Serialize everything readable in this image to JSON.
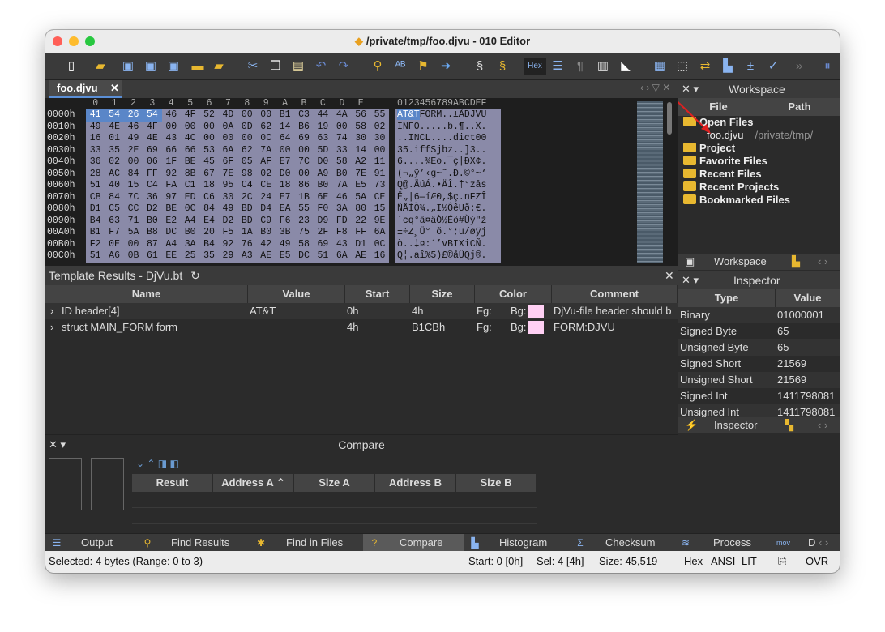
{
  "window": {
    "title": "/private/tmp/foo.djvu - 010 Editor"
  },
  "toolbar": {
    "hex_label": "Hex"
  },
  "doc_tab": {
    "label": "foo.djvu"
  },
  "hex": {
    "col_header": [
      "0",
      "1",
      "2",
      "3",
      "4",
      "5",
      "6",
      "7",
      "8",
      "9",
      "A",
      "B",
      "C",
      "D",
      "E",
      "F"
    ],
    "ascii_header": "0123456789ABCDEF",
    "rows": [
      {
        "addr": "0000h",
        "bytes": "41 54 26 54 46 4F 52 4D 00 00 B1 C3 44 4A 56 55",
        "ascii": "AT&TFORM..±ÃDJVU"
      },
      {
        "addr": "0010h",
        "bytes": "49 4E 46 4F 00 00 00 0A 0D 62 14 B6 19 00 58 02",
        "ascii": "INFO.....b.¶..X."
      },
      {
        "addr": "0020h",
        "bytes": "16 01 49 4E 43 4C 00 00 00 0C 64 69 63 74 30 30",
        "ascii": "..INCL....dict00"
      },
      {
        "addr": "0030h",
        "bytes": "33 35 2E 69 66 66 53 6A 62 7A 00 00 5D 33 14 00",
        "ascii": "35.iffSjbz..]3.."
      },
      {
        "addr": "0040h",
        "bytes": "36 02 00 06 1F BE 45 6F 05 AF E7 7C D0 58 A2 11",
        "ascii": "6....¾Eo.¯ç|ÐX¢."
      },
      {
        "addr": "0050h",
        "bytes": "28 AC 84 FF 92 8B 67 7E 98 02 D0 00 A9 B0 7E 91",
        "ascii": "(¬„ÿ’‹g~˜.Ð.©°~‘"
      },
      {
        "addr": "0060h",
        "bytes": "51 40 15 C4 FA C1 18 95 C4 CE 18 86 B0 7A E5 73",
        "ascii": "Q@.ÄúÁ.•ÄÎ.†°zås"
      },
      {
        "addr": "0070h",
        "bytes": "CB 84 7C 36 97 ED C6 30 2C 24 E7 1B 6E 46 5A CE",
        "ascii": "Ë„|6—íÆ0,$ç.nFZÎ"
      },
      {
        "addr": "0080h",
        "bytes": "D1 C5 CC D2 BE 0C 84 49 BD D4 EA 55 F0 3A 80 15",
        "ascii": "ÑÅÌÒ¾.„I½ÔêUð:€."
      },
      {
        "addr": "0090h",
        "bytes": "B4 63 71 B0 E2 A4 E4 D2 BD C9 F6 23 D9 FD 22 9E",
        "ascii": "´cq°â¤äÒ½Éö#Ùý\"ž"
      },
      {
        "addr": "00A0h",
        "bytes": "B1 F7 5A B8 DC B0 20 F5 1A B0 3B 75 2F F8 FF 6A",
        "ascii": "±÷Z¸Ü° õ.°;u/øÿj"
      },
      {
        "addr": "00B0h",
        "bytes": "F2 0E 00 87 A4 3A B4 92 76 42 49 58 69 43 D1 0C",
        "ascii": "ò..‡¤:´’vBIXiCÑ."
      },
      {
        "addr": "00C0h",
        "bytes": "51 A6 0B 61 EE 25 35 29 A3 AE E5 DC 51 6A AE 16",
        "ascii": "Q¦.aî%5)£®åÜQj®."
      }
    ]
  },
  "template": {
    "title": "Template Results - DjVu.bt",
    "columns": [
      "Name",
      "Value",
      "Start",
      "Size",
      "Color",
      "Comment"
    ],
    "rows": [
      {
        "name": "ID header[4]",
        "value": "AT&T",
        "start": "0h",
        "size": "4h",
        "fg": "Fg:",
        "bg": "Bg:",
        "comment": "DjVu-file header should b"
      },
      {
        "name": "struct MAIN_FORM form",
        "value": "",
        "start": "4h",
        "size": "B1CBh",
        "fg": "Fg:",
        "bg": "Bg:",
        "comment": "FORM:DJVU"
      }
    ]
  },
  "compare": {
    "title": "Compare",
    "columns": [
      "Result",
      "Address A",
      "Size A",
      "Address B",
      "Size B"
    ]
  },
  "workspace": {
    "title": "Workspace",
    "col_file": "File",
    "col_path": "Path",
    "open_files": "Open Files",
    "file_name": "foo.djvu",
    "file_path": "/private/tmp/",
    "items": [
      "Project",
      "Favorite Files",
      "Recent Files",
      "Recent Projects",
      "Bookmarked Files"
    ],
    "tab_label": "Workspace"
  },
  "inspector": {
    "title": "Inspector",
    "col_type": "Type",
    "col_value": "Value",
    "rows": [
      {
        "type": "Binary",
        "value": "01000001"
      },
      {
        "type": "Signed Byte",
        "value": "65"
      },
      {
        "type": "Unsigned Byte",
        "value": "65"
      },
      {
        "type": "Signed Short",
        "value": "21569"
      },
      {
        "type": "Unsigned Short",
        "value": "21569"
      },
      {
        "type": "Signed Int",
        "value": "1411798081"
      },
      {
        "type": "Unsigned Int",
        "value": "1411798081"
      }
    ],
    "tab_label": "Inspector"
  },
  "bottom_tabs": [
    "Output",
    "Find Results",
    "Find in Files",
    "Compare",
    "Histogram",
    "Checksum",
    "Process",
    "D"
  ],
  "status": {
    "selected": "Selected: 4 bytes (Range: 0 to 3)",
    "start": "Start: 0 [0h]",
    "sel": "Sel: 4 [4h]",
    "size": "Size: 45,519",
    "hex": "Hex",
    "ansi": "ANSI",
    "lit": "LIT",
    "ovr": "OVR"
  }
}
